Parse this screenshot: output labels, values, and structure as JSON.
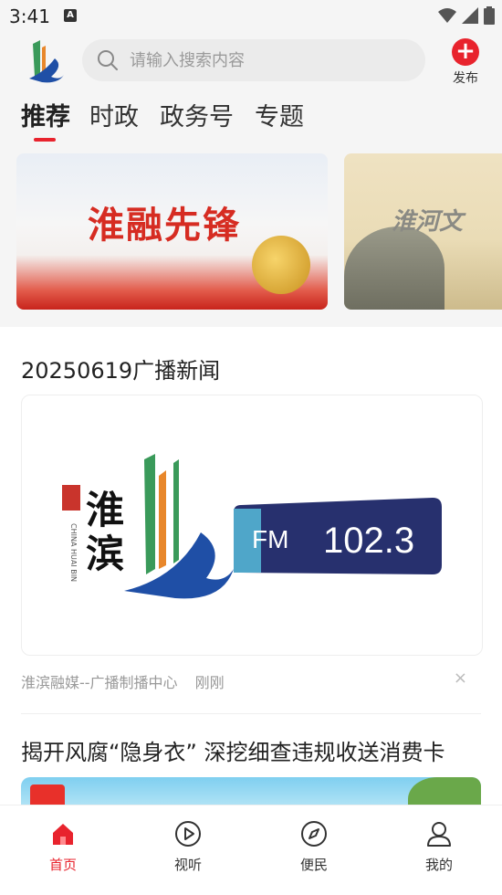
{
  "status_bar": {
    "time": "3:41",
    "a_indicator": "A"
  },
  "header": {
    "search_placeholder": "请输入搜索内容",
    "publish_label": "发布"
  },
  "tabs": [
    {
      "label": "推荐",
      "active": true
    },
    {
      "label": "时政",
      "active": false
    },
    {
      "label": "政务号",
      "active": false
    },
    {
      "label": "专题",
      "active": false
    }
  ],
  "banners": [
    {
      "title": "淮融先锋"
    },
    {
      "title": "淮河文"
    }
  ],
  "feed": [
    {
      "title": "20250619广播新闻",
      "cover": {
        "brand_chars": "淮滨",
        "fm_label": "FM",
        "frequency": "102.3",
        "seal_text": "CHINA HUAI BIN"
      },
      "source": "淮滨融媒--广播制播中心",
      "time": "刚刚",
      "close_icon": "×"
    },
    {
      "title": "揭开风腐“隐身衣” 深挖细查违规收送消费卡"
    }
  ],
  "bottom_nav": [
    {
      "label": "首页",
      "icon": "home-icon",
      "active": true
    },
    {
      "label": "视听",
      "icon": "play-icon",
      "active": false
    },
    {
      "label": "便民",
      "icon": "compass-icon",
      "active": false
    },
    {
      "label": "我的",
      "icon": "user-icon",
      "active": false
    }
  ],
  "colors": {
    "accent": "#e8232d",
    "background": "#f5f5f5"
  }
}
